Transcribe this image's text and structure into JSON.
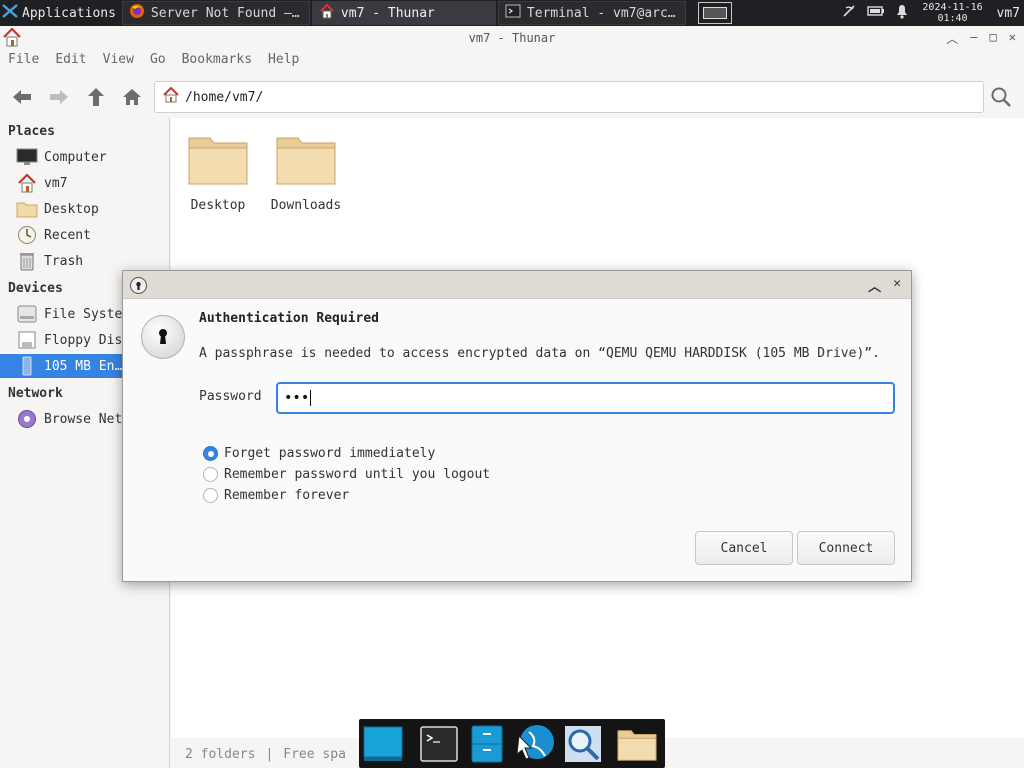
{
  "panel": {
    "applications_label": "Applications",
    "tasks": [
      {
        "label": "Server Not Found —…",
        "icon": "firefox-icon"
      },
      {
        "label": "vm7 - Thunar",
        "icon": "home-folder-icon"
      },
      {
        "label": "Terminal - vm7@arc…",
        "icon": "terminal-icon"
      }
    ],
    "clock_date": "2024-11-16",
    "clock_time": "01:40",
    "user": "vm7"
  },
  "window": {
    "title": "vm7 - Thunar",
    "menu": [
      "File",
      "Edit",
      "View",
      "Go",
      "Bookmarks",
      "Help"
    ],
    "location_path": "/home/vm7/"
  },
  "sidebar": {
    "places_heading": "Places",
    "places": [
      {
        "label": "Computer",
        "icon": "computer-icon"
      },
      {
        "label": "vm7",
        "icon": "home-icon"
      },
      {
        "label": "Desktop",
        "icon": "folder-icon"
      },
      {
        "label": "Recent",
        "icon": "recent-icon"
      },
      {
        "label": "Trash",
        "icon": "trash-icon"
      }
    ],
    "devices_heading": "Devices",
    "devices": [
      {
        "label": "File Syste",
        "icon": "drive-icon"
      },
      {
        "label": "Floppy Dis",
        "icon": "floppy-icon"
      },
      {
        "label": "105 MB En…",
        "icon": "usb-drive-icon",
        "selected": true
      }
    ],
    "network_heading": "Network",
    "network": [
      {
        "label": "Browse Net",
        "icon": "network-icon"
      }
    ]
  },
  "content": {
    "folders": [
      "Desktop",
      "Downloads"
    ]
  },
  "statusbar": {
    "count": "2 folders",
    "sep": "|",
    "free": "Free spa"
  },
  "dialog": {
    "heading": "Authentication Required",
    "message": "A passphrase is needed to access encrypted data on “QEMU QEMU HARDDISK (105 MB Drive)”.",
    "password_label": "Password",
    "password_value": "•••",
    "radio_options": [
      {
        "label": "Forget password immediately",
        "checked": true
      },
      {
        "label": "Remember password until you logout",
        "checked": false
      },
      {
        "label": "Remember forever",
        "checked": false
      }
    ],
    "cancel_label": "Cancel",
    "connect_label": "Connect"
  },
  "colors": {
    "accent": "#3584e4",
    "panel_bg": "#1f2023",
    "dialog_title_bg": "#e0dcd5"
  }
}
